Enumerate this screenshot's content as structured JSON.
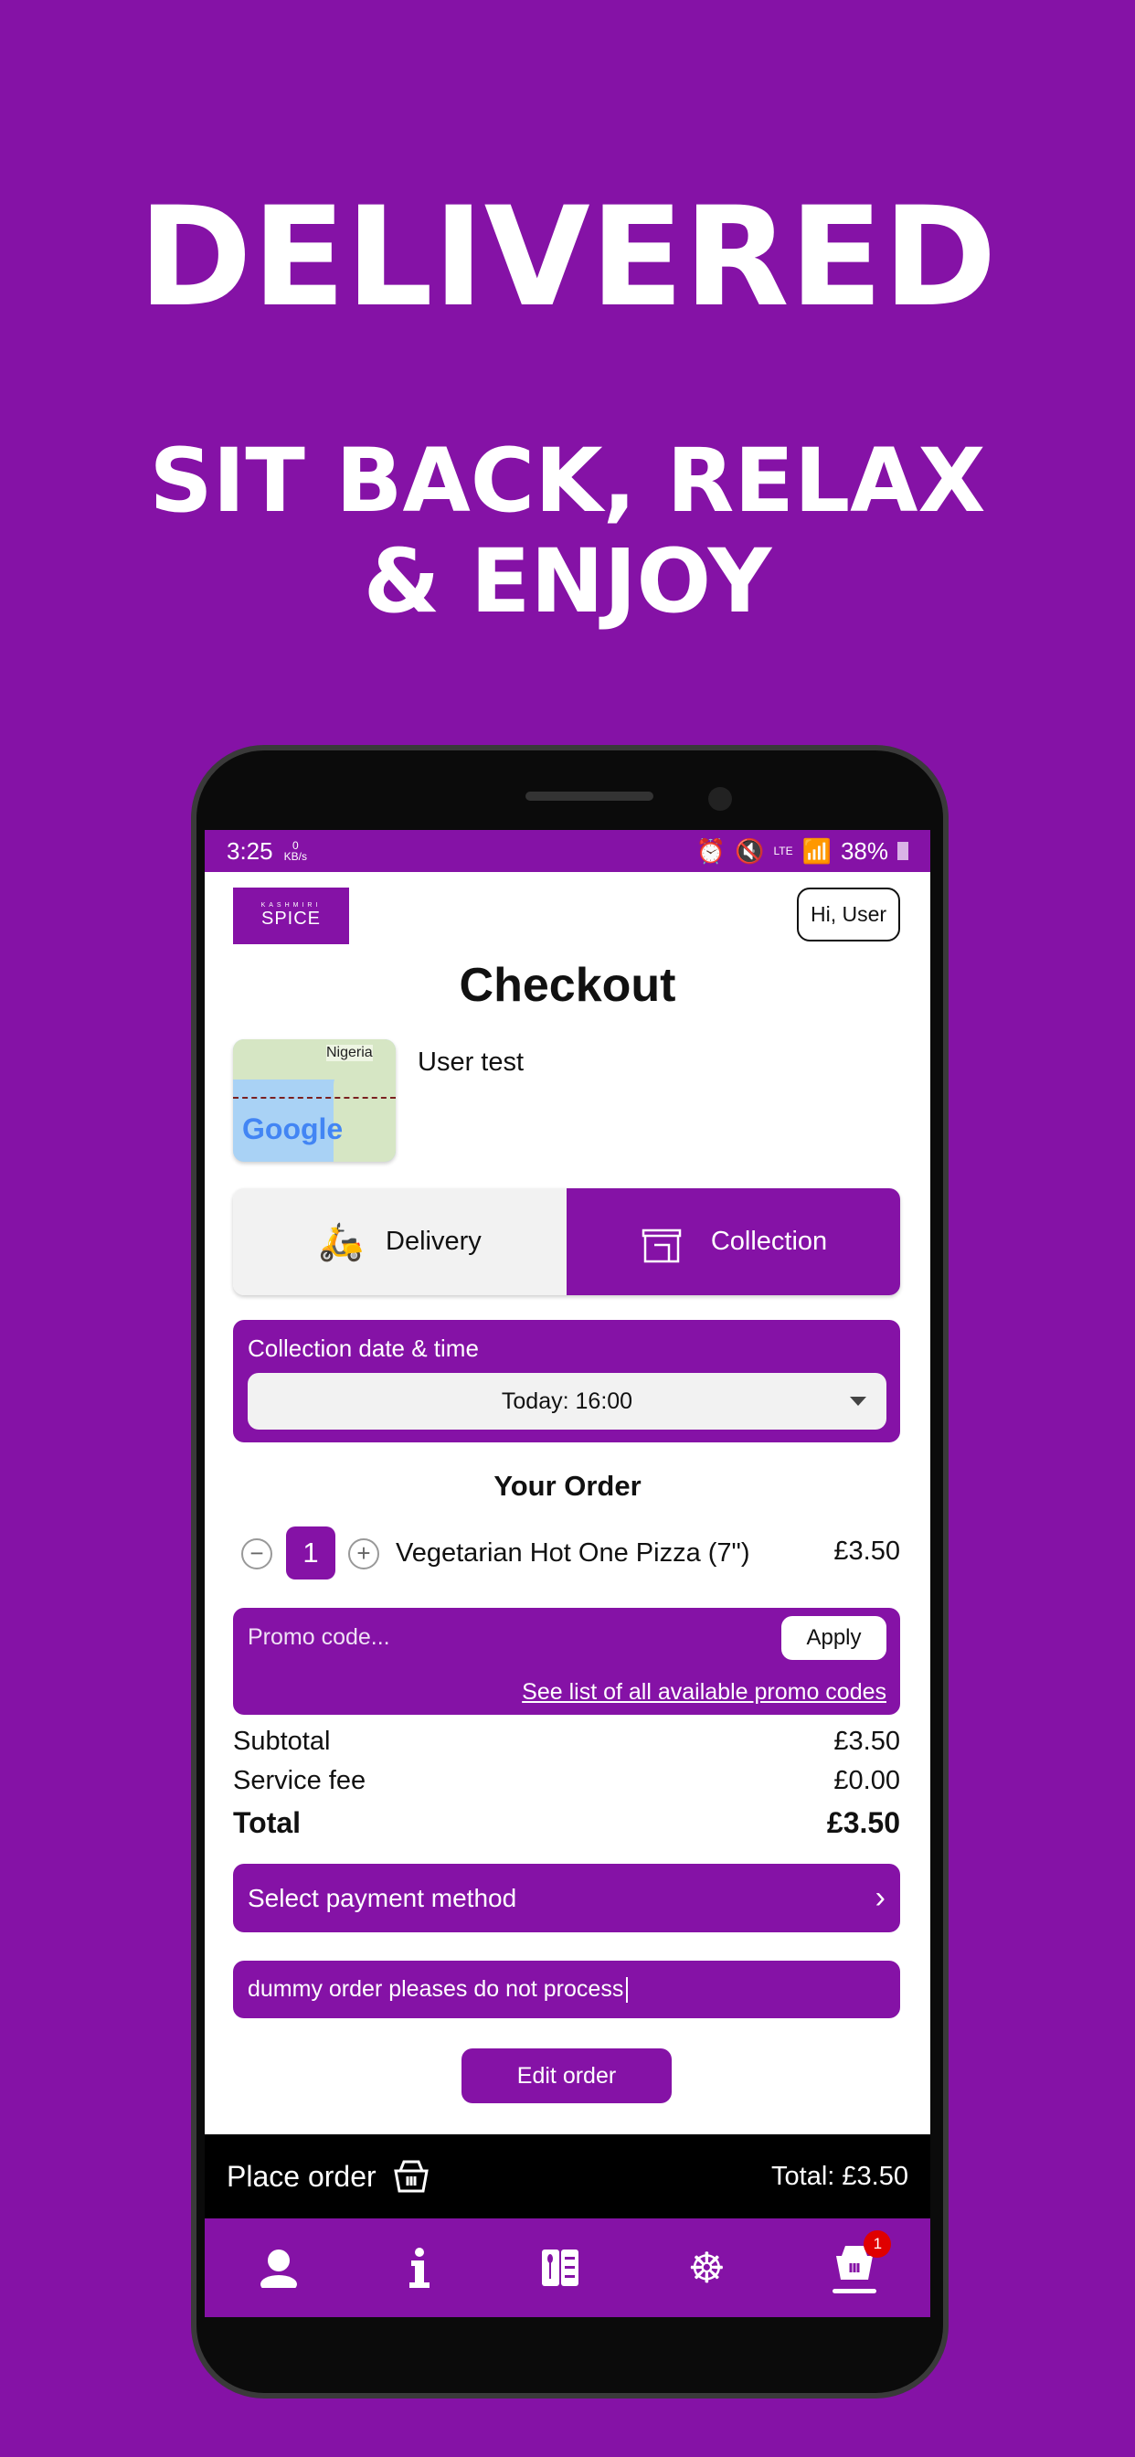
{
  "promo": {
    "headline": "DELIVERED",
    "line1": "SIT BACK, RELAX",
    "line2": "& ENJOY"
  },
  "status_bar": {
    "time": "3:25",
    "data_rate": "0",
    "data_unit": "KB/s",
    "network": "LTE",
    "battery": "38%"
  },
  "header": {
    "logo_top": "KASHMIRI",
    "logo_main": "SPICE",
    "user_button": "Hi, User"
  },
  "page_title": "Checkout",
  "map": {
    "country_label": "Nigeria",
    "brand": "Google"
  },
  "address_name": "User test",
  "mode_toggle": {
    "delivery": "Delivery",
    "collection": "Collection",
    "selected": "Collection"
  },
  "collection": {
    "label": "Collection date & time",
    "value": "Today: 16:00"
  },
  "order": {
    "heading": "Your Order",
    "items": [
      {
        "qty": "1",
        "name": "Vegetarian Hot One Pizza (7\")",
        "price": "£3.50"
      }
    ]
  },
  "promo_code": {
    "placeholder": "Promo code...",
    "apply": "Apply",
    "link": "See list of all available promo codes"
  },
  "totals": {
    "subtotal_label": "Subtotal",
    "subtotal": "£3.50",
    "fee_label": "Service fee",
    "fee": "£0.00",
    "total_label": "Total",
    "total": "£3.50"
  },
  "payment": {
    "label": "Select payment method"
  },
  "notes": {
    "value": "dummy order pleases do not process"
  },
  "edit_order": "Edit order",
  "footer": {
    "place_order": "Place order",
    "total": "Total: £3.50"
  },
  "nav": {
    "items": [
      "profile",
      "info",
      "menu",
      "settings",
      "basket"
    ],
    "active": "basket",
    "basket_badge": "1"
  },
  "colors": {
    "brand": "#8512a6",
    "badge": "#e00000"
  }
}
